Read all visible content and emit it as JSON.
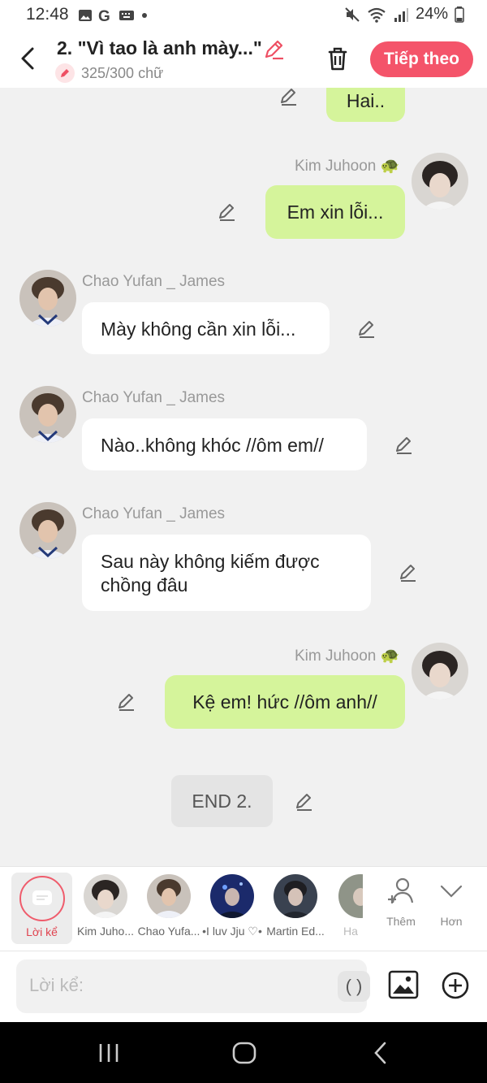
{
  "status": {
    "time": "12:48",
    "battery": "24%"
  },
  "header": {
    "title": "2. \"Vì tao là anh mày...\"",
    "char_count": "325/300 chữ",
    "next_label": "Tiếp theo"
  },
  "messages": [
    {
      "text": "Hai.."
    },
    {
      "name": "Kim Juhoon 🐢",
      "text": "Em xin lỗi..."
    },
    {
      "name": "Chao Yufan _ James",
      "text": "Mày không cần xin lỗi..."
    },
    {
      "name": "Chao Yufan _ James",
      "text": "Nào..không khóc //ôm em//"
    },
    {
      "name": "Chao Yufan _ James",
      "line1": "Sau này không kiếm được",
      "line2": "chồng đâu"
    },
    {
      "name": "Kim Juhoon 🐢",
      "text": "Kệ em! hức //ôm anh//"
    }
  ],
  "end_label": "END 2.",
  "characters": {
    "narration_label": "Lời kể",
    "items": [
      "Kim Juho...",
      "Chao Yufa...",
      "•I luv Jju ♡•",
      "Martin Ed...",
      "Ha"
    ],
    "add_label": "Thêm",
    "more_label": "Hơn"
  },
  "input": {
    "placeholder": "Lời kể:",
    "paren": "( )"
  },
  "colors": {
    "accent": "#f4546a",
    "green_bubble": "#d5f49b",
    "background": "#f1f1f1"
  }
}
